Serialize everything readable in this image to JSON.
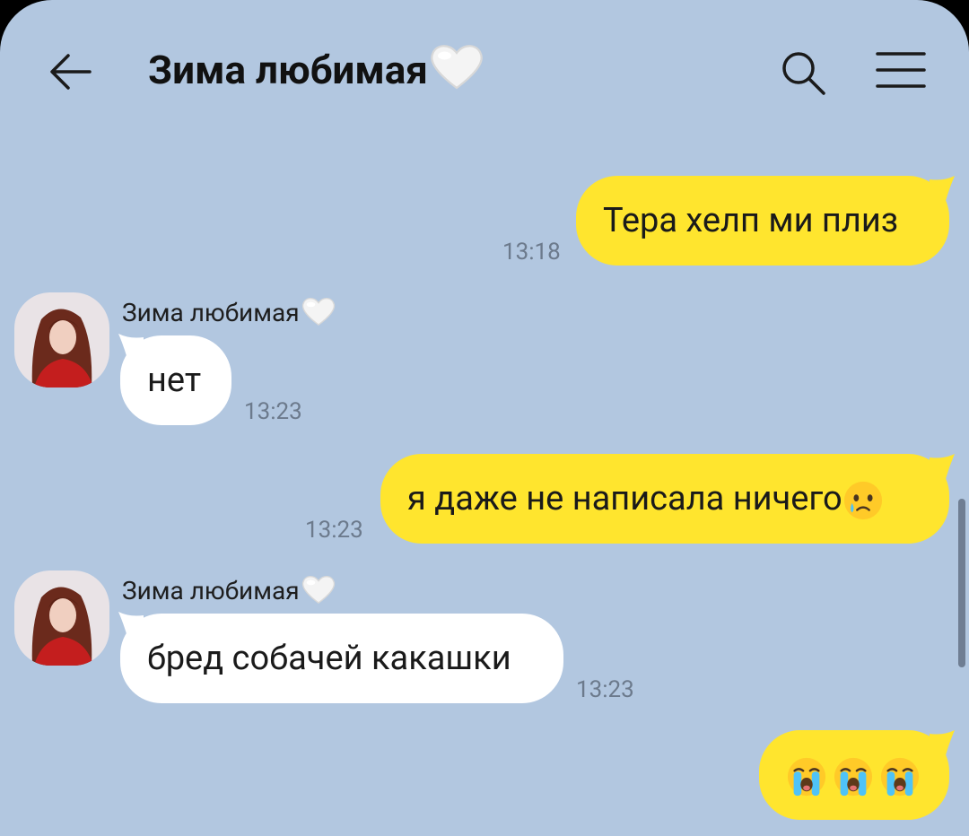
{
  "header": {
    "title": "Зима любимая",
    "back_icon": "arrow-left-icon",
    "search_icon": "search-icon",
    "menu_icon": "hamburger-menu-icon"
  },
  "messages": [
    {
      "direction": "outgoing",
      "text": "Тера хелп ми плиз",
      "time": "13:18"
    },
    {
      "direction": "incoming",
      "sender": "Зима любимая",
      "text": "нет",
      "time": "13:23"
    },
    {
      "direction": "outgoing",
      "text": "я даже не написала ничего",
      "emoji": "crying-face",
      "time": "13:23"
    },
    {
      "direction": "incoming",
      "sender": "Зима любимая",
      "text": "бред собачей какашки",
      "time": "13:23"
    },
    {
      "direction": "outgoing",
      "text": "",
      "emoji": "loudly-crying-face x3"
    }
  ],
  "colors": {
    "background": "#b2c7e0",
    "outgoing_bubble": "#ffe52e",
    "incoming_bubble": "#ffffff",
    "time_text": "#6c7a8c"
  }
}
